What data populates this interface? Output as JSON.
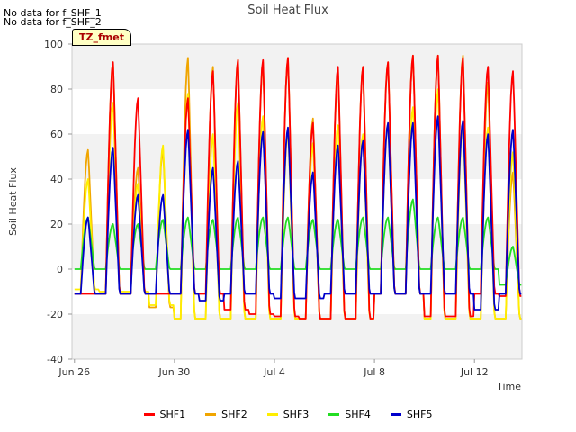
{
  "notes": [
    "No data for f_SHF_1",
    "No data for f_SHF_2"
  ],
  "badge": "TZ_fmet",
  "colors": {
    "SHF1": "#ff0000",
    "SHF2": "#f0a500",
    "SHF3": "#ffee00",
    "SHF4": "#22dd22",
    "SHF5": "#0000cc"
  },
  "chart_data": {
    "type": "line",
    "title": "Soil Heat Flux",
    "xlabel": "Time",
    "ylabel": "Soil Heat Flux",
    "ylim": [
      -40,
      100
    ],
    "yticks": [
      -40,
      -20,
      0,
      20,
      40,
      60,
      80,
      100
    ],
    "x_tick_labels": [
      "Jun 26",
      "Jun 30",
      "Jul 4",
      "Jul 8",
      "Jul 12"
    ],
    "x_tick_days": [
      0,
      4,
      8,
      12,
      16
    ],
    "xlim_days": [
      -0.1,
      17.9
    ],
    "x_units": "days since Jun 26",
    "grid": "horizontal bands",
    "legend_position": "bottom",
    "days": [
      0,
      1,
      2,
      3,
      4,
      5,
      6,
      7,
      8,
      9,
      10,
      11,
      12,
      13,
      14,
      15,
      16,
      17
    ],
    "series": [
      {
        "name": "SHF1",
        "peaks": [
          null,
          92,
          76,
          null,
          76,
          88,
          93,
          93,
          94,
          65,
          90,
          90,
          92,
          95,
          95,
          94,
          90,
          88
        ],
        "troughs": [
          -11,
          -11,
          -11,
          -11,
          -11,
          -11,
          -18,
          -20,
          -21,
          -22,
          -22,
          -22,
          -11,
          -11,
          -21,
          -21,
          -11,
          -12
        ]
      },
      {
        "name": "SHF2",
        "peaks": [
          53,
          92,
          45,
          53,
          94,
          90,
          93,
          92,
          94,
          67,
          88,
          90,
          92,
          95,
          95,
          95,
          83,
          43
        ],
        "troughs": [
          -11,
          -11,
          -11,
          -17,
          -22,
          -22,
          -22,
          -22,
          -22,
          -22,
          -22,
          -22,
          -11,
          -11,
          -22,
          -22,
          -22,
          -22
        ]
      },
      {
        "name": "SHF3",
        "peaks": [
          40,
          74,
          38,
          55,
          78,
          60,
          74,
          68,
          62,
          56,
          64,
          60,
          65,
          72,
          80,
          65,
          63,
          52
        ],
        "troughs": [
          -9,
          -10,
          -10,
          -16,
          -22,
          -22,
          -22,
          -22,
          -22,
          -22,
          -22,
          -22,
          -11,
          -11,
          -22,
          -22,
          -22,
          -22
        ]
      },
      {
        "name": "SHF4",
        "peaks": [
          23,
          20,
          20,
          22,
          23,
          22,
          23,
          23,
          23,
          22,
          22,
          23,
          23,
          31,
          23,
          23,
          23,
          10
        ],
        "troughs": [
          0,
          0,
          0,
          0,
          0,
          0,
          0,
          0,
          0,
          0,
          0,
          0,
          0,
          0,
          0,
          0,
          0,
          -7
        ]
      },
      {
        "name": "SHF5",
        "peaks": [
          23,
          54,
          33,
          33,
          62,
          45,
          48,
          61,
          63,
          43,
          55,
          57,
          65,
          65,
          68,
          66,
          60,
          62
        ],
        "troughs": [
          -11,
          -11,
          -11,
          -11,
          -11,
          -14,
          -11,
          -11,
          -13,
          -13,
          -11,
          -11,
          -11,
          -11,
          -11,
          -11,
          -18,
          -11
        ]
      }
    ]
  }
}
